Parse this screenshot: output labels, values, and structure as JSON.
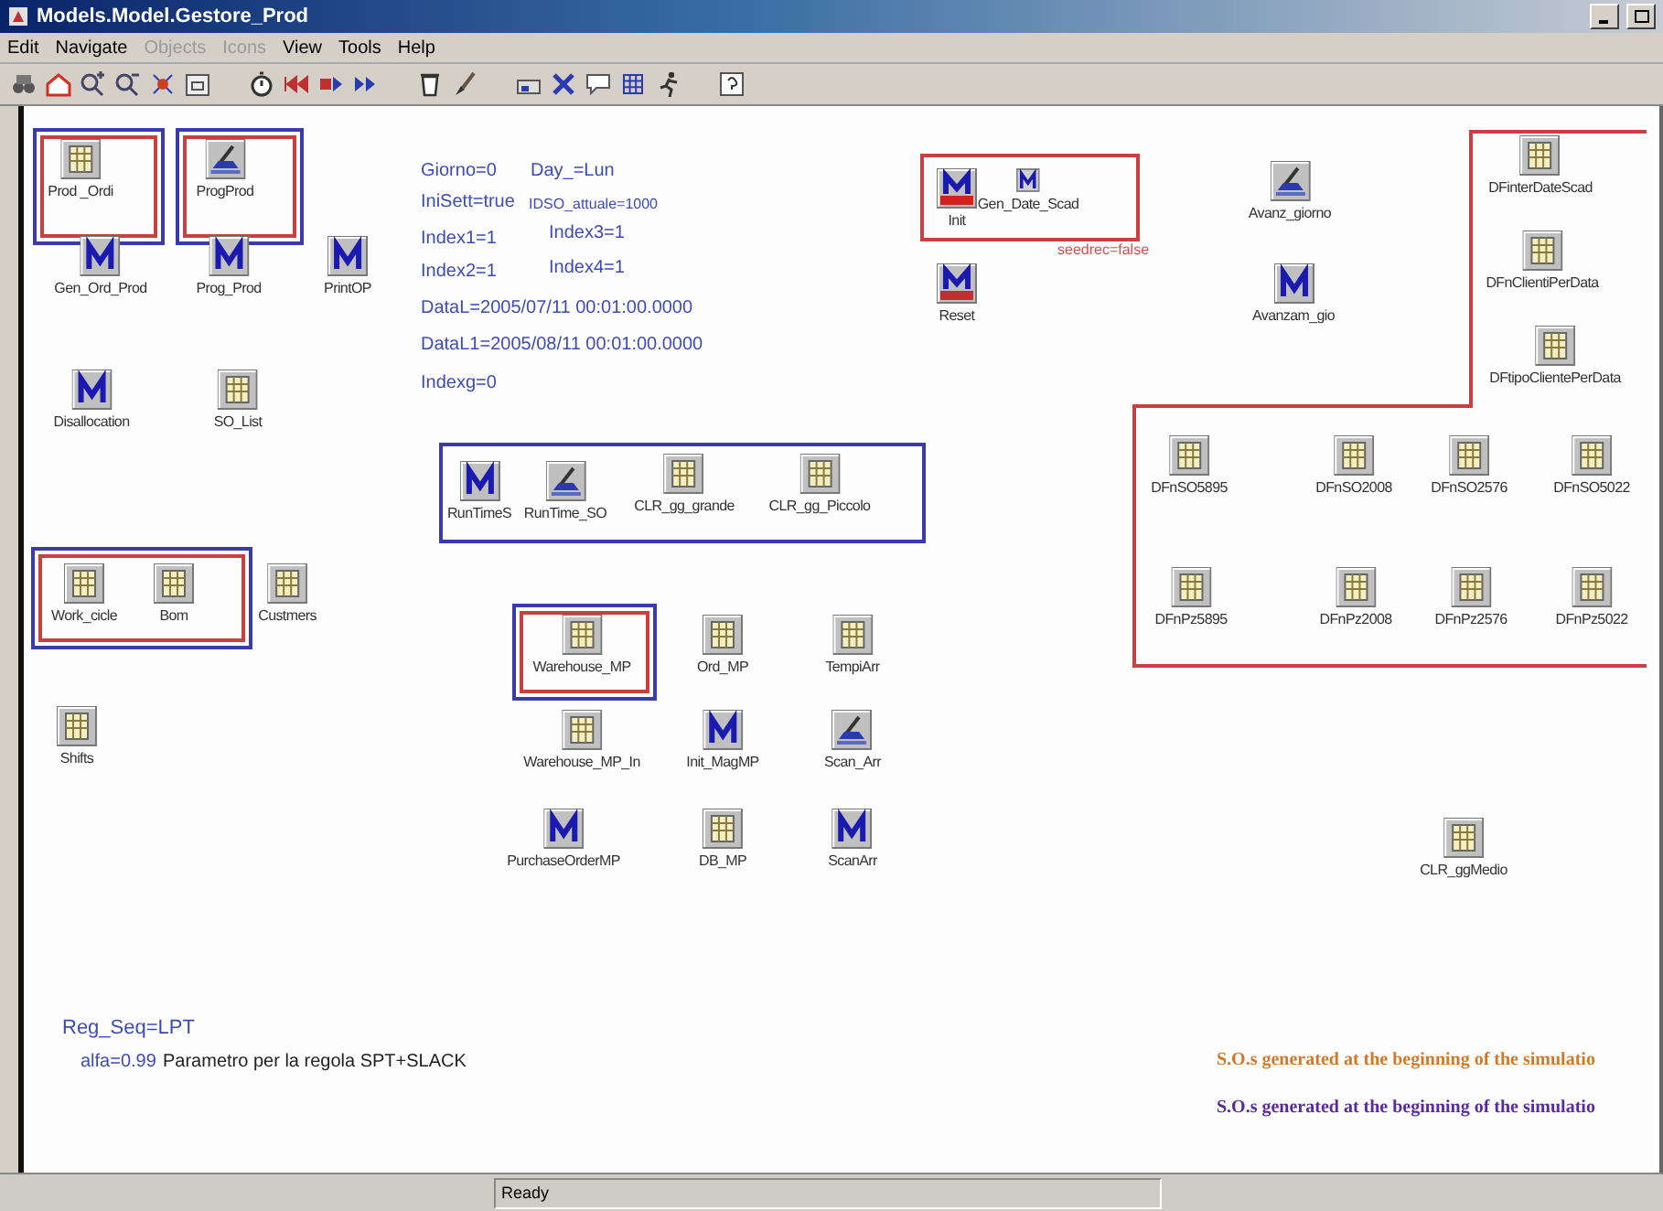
{
  "window": {
    "title": "Models.Model.Gestore_Prod"
  },
  "menu": [
    {
      "label": "Edit",
      "disabled": false
    },
    {
      "label": "Navigate",
      "disabled": false
    },
    {
      "label": "Objects",
      "disabled": true
    },
    {
      "label": "Icons",
      "disabled": true
    },
    {
      "label": "View",
      "disabled": false
    },
    {
      "label": "Tools",
      "disabled": false
    },
    {
      "label": "Help",
      "disabled": false
    }
  ],
  "frames": [
    {
      "kind": "box",
      "color": "#3a3aa8"
    },
    {
      "kind": "box",
      "color": "#c84040"
    },
    {
      "kind": "box",
      "color": "#3a3aa8"
    },
    {
      "kind": "box",
      "color": "#c84040"
    },
    {
      "kind": "box",
      "color": "#3a3aa8"
    },
    {
      "kind": "box",
      "color": "#3a3aa8"
    },
    {
      "kind": "box",
      "color": "#c84040"
    },
    {
      "kind": "box",
      "color": "#3a3aa8"
    },
    {
      "kind": "box",
      "color": "#c84040"
    },
    {
      "kind": "box",
      "color": "#c84040"
    },
    {
      "kind": "region",
      "color": "#c84040"
    }
  ],
  "nodes": [
    {
      "label": "Prod _Ordi",
      "kind": "table"
    },
    {
      "label": "ProgProd",
      "kind": "scheduler"
    },
    {
      "label": "Gen_Ord_Prod",
      "kind": "macro"
    },
    {
      "label": "Prog_Prod",
      "kind": "macro"
    },
    {
      "label": "PrintOP",
      "kind": "macro"
    },
    {
      "label": "Disallocation",
      "kind": "macro"
    },
    {
      "label": "SO_List",
      "kind": "table"
    },
    {
      "label": "RunTimeS",
      "kind": "macro"
    },
    {
      "label": "RunTime_SO",
      "kind": "scheduler"
    },
    {
      "label": "CLR_gg_grande",
      "kind": "table"
    },
    {
      "label": "CLR_gg_Piccolo",
      "kind": "table"
    },
    {
      "label": "Work_cicle",
      "kind": "table"
    },
    {
      "label": "Bom",
      "kind": "table"
    },
    {
      "label": "Custmers",
      "kind": "table"
    },
    {
      "label": "Shifts",
      "kind": "table"
    },
    {
      "label": "Warehouse_MP",
      "kind": "table"
    },
    {
      "label": "Ord_MP",
      "kind": "table"
    },
    {
      "label": "TempiArr",
      "kind": "table"
    },
    {
      "label": "Warehouse_MP_In",
      "kind": "table"
    },
    {
      "label": "Init_MagMP",
      "kind": "macro"
    },
    {
      "label": "Scan_Arr",
      "kind": "scheduler"
    },
    {
      "label": "PurchaseOrderMP",
      "kind": "macro"
    },
    {
      "label": "DB_MP",
      "kind": "table"
    },
    {
      "label": "ScanArr",
      "kind": "macro"
    },
    {
      "label": "Init",
      "kind": "macro-init"
    },
    {
      "label": "Gen_Date_Scad",
      "kind": "macro-small"
    },
    {
      "label": "Reset",
      "kind": "macro-reset"
    },
    {
      "label": "Avanz_giorno",
      "kind": "scheduler"
    },
    {
      "label": "Avanzam_gio",
      "kind": "macro"
    },
    {
      "label": "DFinterDateScad",
      "kind": "table"
    },
    {
      "label": "DFnClientiPerData",
      "kind": "table"
    },
    {
      "label": "DFtipoClientePerData",
      "kind": "table"
    },
    {
      "label": "DFnSO5895",
      "kind": "table"
    },
    {
      "label": "DFnSO2008",
      "kind": "table"
    },
    {
      "label": "DFnSO2576",
      "kind": "table"
    },
    {
      "label": "DFnSO5022",
      "kind": "table"
    },
    {
      "label": "DFnPz5895",
      "kind": "table"
    },
    {
      "label": "DFnPz2008",
      "kind": "table"
    },
    {
      "label": "DFnPz2576",
      "kind": "table"
    },
    {
      "label": "DFnPz5022",
      "kind": "table"
    },
    {
      "label": "CLR_ggMedio",
      "kind": "table"
    }
  ],
  "texts": [
    {
      "text": "Giorno=0",
      "kind": "variable",
      "color": "#3d4bb5"
    },
    {
      "text": "Day_=Lun",
      "kind": "variable",
      "color": "#3d4bb5"
    },
    {
      "text": "IniSett=true",
      "kind": "variable",
      "color": "#3d4bb5"
    },
    {
      "text": "IDSO_attuale=1000",
      "kind": "variable",
      "color": "#3d4bb5"
    },
    {
      "text": "Index1=1",
      "kind": "variable",
      "color": "#3d4bb5"
    },
    {
      "text": "Index3=1",
      "kind": "variable",
      "color": "#3d4bb5"
    },
    {
      "text": "Index2=1",
      "kind": "variable",
      "color": "#3d4bb5"
    },
    {
      "text": "Index4=1",
      "kind": "variable",
      "color": "#3d4bb5"
    },
    {
      "text": "DataL=2005/07/11 00:01:00.0000",
      "kind": "variable",
      "color": "#3d4bb5"
    },
    {
      "text": "DataL1=2005/08/11 00:01:00.0000",
      "kind": "variable",
      "color": "#3d4bb5"
    },
    {
      "text": "Indexg=0",
      "kind": "variable",
      "color": "#3d4bb5"
    },
    {
      "text": "seedrec=false",
      "kind": "variable",
      "color": "#d05050"
    },
    {
      "text": "Reg_Seq=LPT",
      "kind": "variable",
      "color": "#3d4bb5"
    },
    {
      "text": "alfa=0.99",
      "kind": "variable",
      "color": "#3d4bb5"
    },
    {
      "text": "Parametro per la regola SPT+SLACK",
      "kind": "variable",
      "color": "#222222"
    },
    {
      "text": "S.O.s generated at the beginning of the simulatio",
      "kind": "note",
      "color": "#d07a28"
    },
    {
      "text": "S.O.s generated at the beginning of the simulatio",
      "kind": "note",
      "color": "#5a2aa0"
    }
  ],
  "status_bar": {
    "text": "Ready"
  }
}
